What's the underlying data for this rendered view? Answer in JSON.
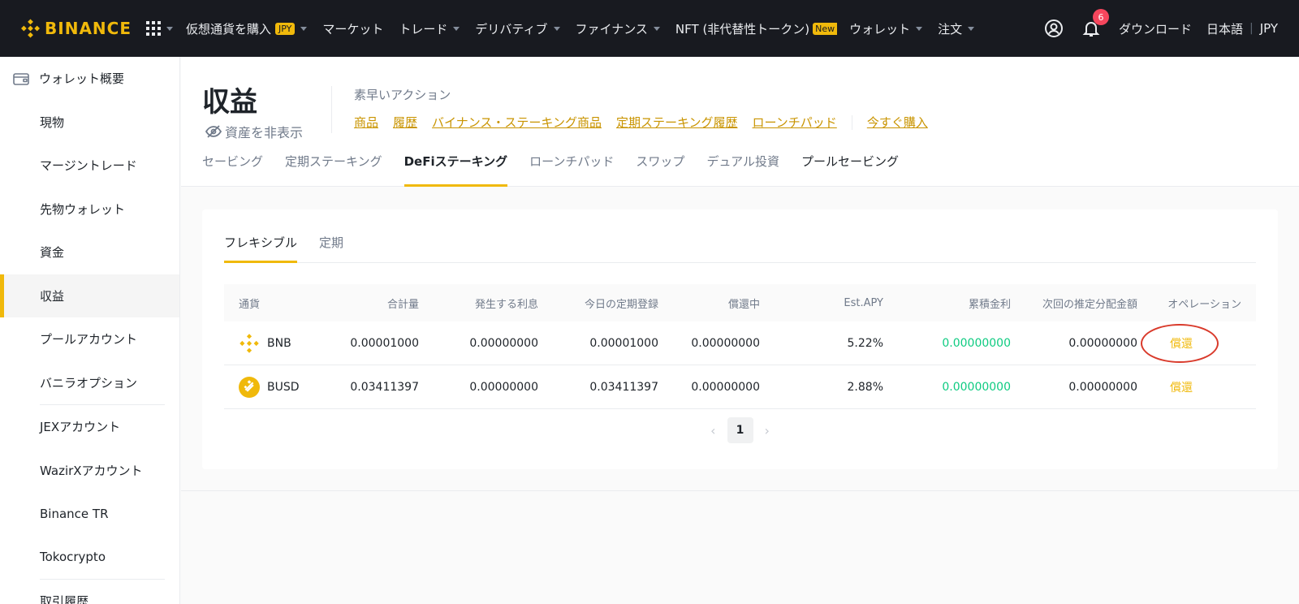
{
  "brand": {
    "name": "BINANCE",
    "color": "#f0b90b"
  },
  "topnav": {
    "items": [
      {
        "label": "仮想通貨を購入",
        "badge": "JPY",
        "dropdown": true
      },
      {
        "label": "マーケット",
        "dropdown": false
      },
      {
        "label": "トレード",
        "dropdown": true
      },
      {
        "label": "デリバティブ",
        "dropdown": true
      },
      {
        "label": "ファイナンス",
        "dropdown": true
      },
      {
        "label": "NFT (非代替性トークン)",
        "badge": "New",
        "dropdown": false
      },
      {
        "label": "ウォレット",
        "dropdown": true
      },
      {
        "label": "注文",
        "dropdown": true
      }
    ],
    "notification_count": "6",
    "download": "ダウンロード",
    "language": "日本語",
    "separator": "|",
    "currency": "JPY"
  },
  "sidebar": {
    "overview": "ウォレット概要",
    "items": [
      "現物",
      "マージントレード",
      "先物ウォレット",
      "資金",
      "収益",
      "プールアカウント",
      "バニラオプション",
      "JEXアカウント",
      "WazirXアカウント",
      "Binance TR",
      "Tokocrypto",
      "取引履歴"
    ],
    "active_index": 4
  },
  "header": {
    "title": "収益",
    "hide_assets": "資産を非表示",
    "quick_actions_label": "素早いアクション",
    "quick_links": [
      "商品",
      "履歴",
      "バイナンス・ステーキング商品",
      "定期ステーキング履歴",
      "ローンチパッド"
    ],
    "buy_now": "今すぐ購入",
    "tabs": [
      "セービング",
      "定期ステーキング",
      "DeFiステーキング",
      "ローンチパッド",
      "スワップ",
      "デュアル投資",
      "プールセービング"
    ],
    "active_tab": 2
  },
  "card": {
    "sub_tabs": [
      "フレキシブル",
      "定期"
    ],
    "active_sub_tab": 0,
    "table": {
      "headers": [
        "通貨",
        "合計量",
        "発生する利息",
        "今日の定期登録",
        "償還中",
        "Est.APY",
        "累積金利",
        "次回の推定分配金額",
        "オペレーション"
      ],
      "rows": [
        {
          "coin": "BNB",
          "total": "0.00001000",
          "interest": "0.00000000",
          "today_sub": "0.00001000",
          "redeeming": "0.00000000",
          "apy": "5.22%",
          "cumulative": "0.00000000",
          "next": "0.00000000",
          "action": "償還"
        },
        {
          "coin": "BUSD",
          "total": "0.03411397",
          "interest": "0.00000000",
          "today_sub": "0.03411397",
          "redeeming": "0.00000000",
          "apy": "2.88%",
          "cumulative": "0.00000000",
          "next": "0.00000000",
          "action": "償還"
        }
      ]
    },
    "pagination": {
      "current": "1"
    }
  },
  "colors": {
    "accent": "#f0b90b",
    "positive": "#0ecb81",
    "annotation": "#d93a2b"
  }
}
